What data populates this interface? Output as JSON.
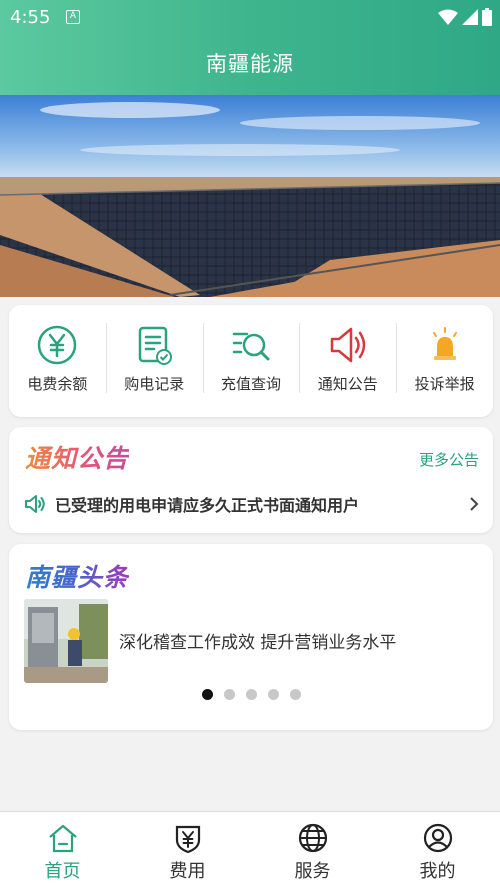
{
  "status_bar": {
    "time": "4:55",
    "notification_icon": "A"
  },
  "header": {
    "title": "南疆能源"
  },
  "quick_actions": [
    {
      "label": "电费余额",
      "icon": "yuan-circle-icon"
    },
    {
      "label": "购电记录",
      "icon": "document-check-icon"
    },
    {
      "label": "充值查询",
      "icon": "list-search-icon"
    },
    {
      "label": "通知公告",
      "icon": "speaker-icon"
    },
    {
      "label": "投诉举报",
      "icon": "alarm-light-icon"
    }
  ],
  "notice": {
    "title": "通知公告",
    "more_label": "更多公告",
    "item": "已受理的用电申请应多久正式书面通知用户"
  },
  "news": {
    "title": "南疆头条",
    "headline": "深化稽查工作成效 提升营销业务水平",
    "carousel_total": 5,
    "carousel_active": 1
  },
  "tabs": [
    {
      "label": "首页",
      "icon": "home-icon",
      "active": true
    },
    {
      "label": "费用",
      "icon": "yuan-shield-icon",
      "active": false
    },
    {
      "label": "服务",
      "icon": "globe-icon",
      "active": false
    },
    {
      "label": "我的",
      "icon": "user-icon",
      "active": false
    }
  ],
  "colors": {
    "brand": "#2aa37d",
    "header_start": "#5cc9a0",
    "header_end": "#2fa886"
  }
}
